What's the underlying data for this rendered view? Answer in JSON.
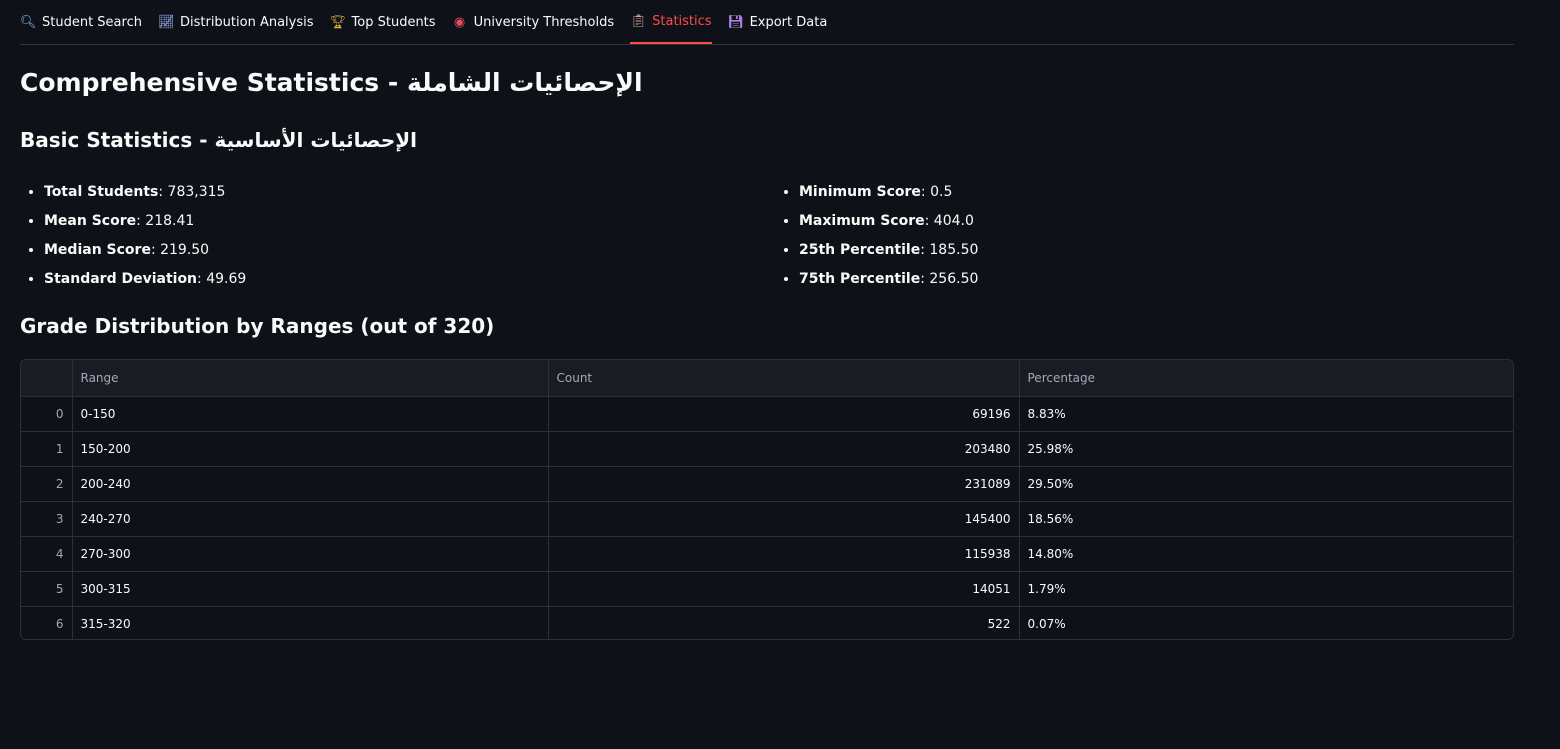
{
  "tabs": [
    {
      "label": "Student Search",
      "icon": "search-icon",
      "active": false
    },
    {
      "label": "Distribution Analysis",
      "icon": "chart-icon",
      "active": false
    },
    {
      "label": "Top Students",
      "icon": "trophy-icon",
      "active": false
    },
    {
      "label": "University Thresholds",
      "icon": "target-icon",
      "active": false
    },
    {
      "label": "Statistics",
      "icon": "clipboard-icon",
      "active": true
    },
    {
      "label": "Export Data",
      "icon": "floppy-disk-icon",
      "active": false
    }
  ],
  "page_title": "Comprehensive Statistics - الإحصائيات الشاملة",
  "basic_title": "Basic Statistics - الإحصائيات الأساسية",
  "stats_left": [
    {
      "label": "Total Students",
      "value": ": 783,315"
    },
    {
      "label": "Mean Score",
      "value": ": 218.41"
    },
    {
      "label": "Median Score",
      "value": ": 219.50"
    },
    {
      "label": "Standard Deviation",
      "value": ": 49.69"
    }
  ],
  "stats_right": [
    {
      "label": "Minimum Score",
      "value": ": 0.5"
    },
    {
      "label": "Maximum Score",
      "value": ": 404.0"
    },
    {
      "label": "25th Percentile",
      "value": ": 185.50"
    },
    {
      "label": "75th Percentile",
      "value": ": 256.50"
    }
  ],
  "distribution_title": "Grade Distribution by Ranges (out of 320)",
  "table": {
    "headers": [
      "",
      "Range",
      "Count",
      "Percentage"
    ],
    "rows": [
      {
        "index": "0",
        "range": "0-150",
        "count": "69196",
        "percentage": "8.83%"
      },
      {
        "index": "1",
        "range": "150-200",
        "count": "203480",
        "percentage": "25.98%"
      },
      {
        "index": "2",
        "range": "200-240",
        "count": "231089",
        "percentage": "29.50%"
      },
      {
        "index": "3",
        "range": "240-270",
        "count": "145400",
        "percentage": "18.56%"
      },
      {
        "index": "4",
        "range": "270-300",
        "count": "115938",
        "percentage": "14.80%"
      },
      {
        "index": "5",
        "range": "300-315",
        "count": "14051",
        "percentage": "1.79%"
      },
      {
        "index": "6",
        "range": "315-320",
        "count": "522",
        "percentage": "0.07%"
      }
    ]
  },
  "colors": {
    "background": "#0e1117",
    "accent": "#ff4b4b",
    "text": "#fafafa",
    "muted": "#a3a8b8"
  }
}
